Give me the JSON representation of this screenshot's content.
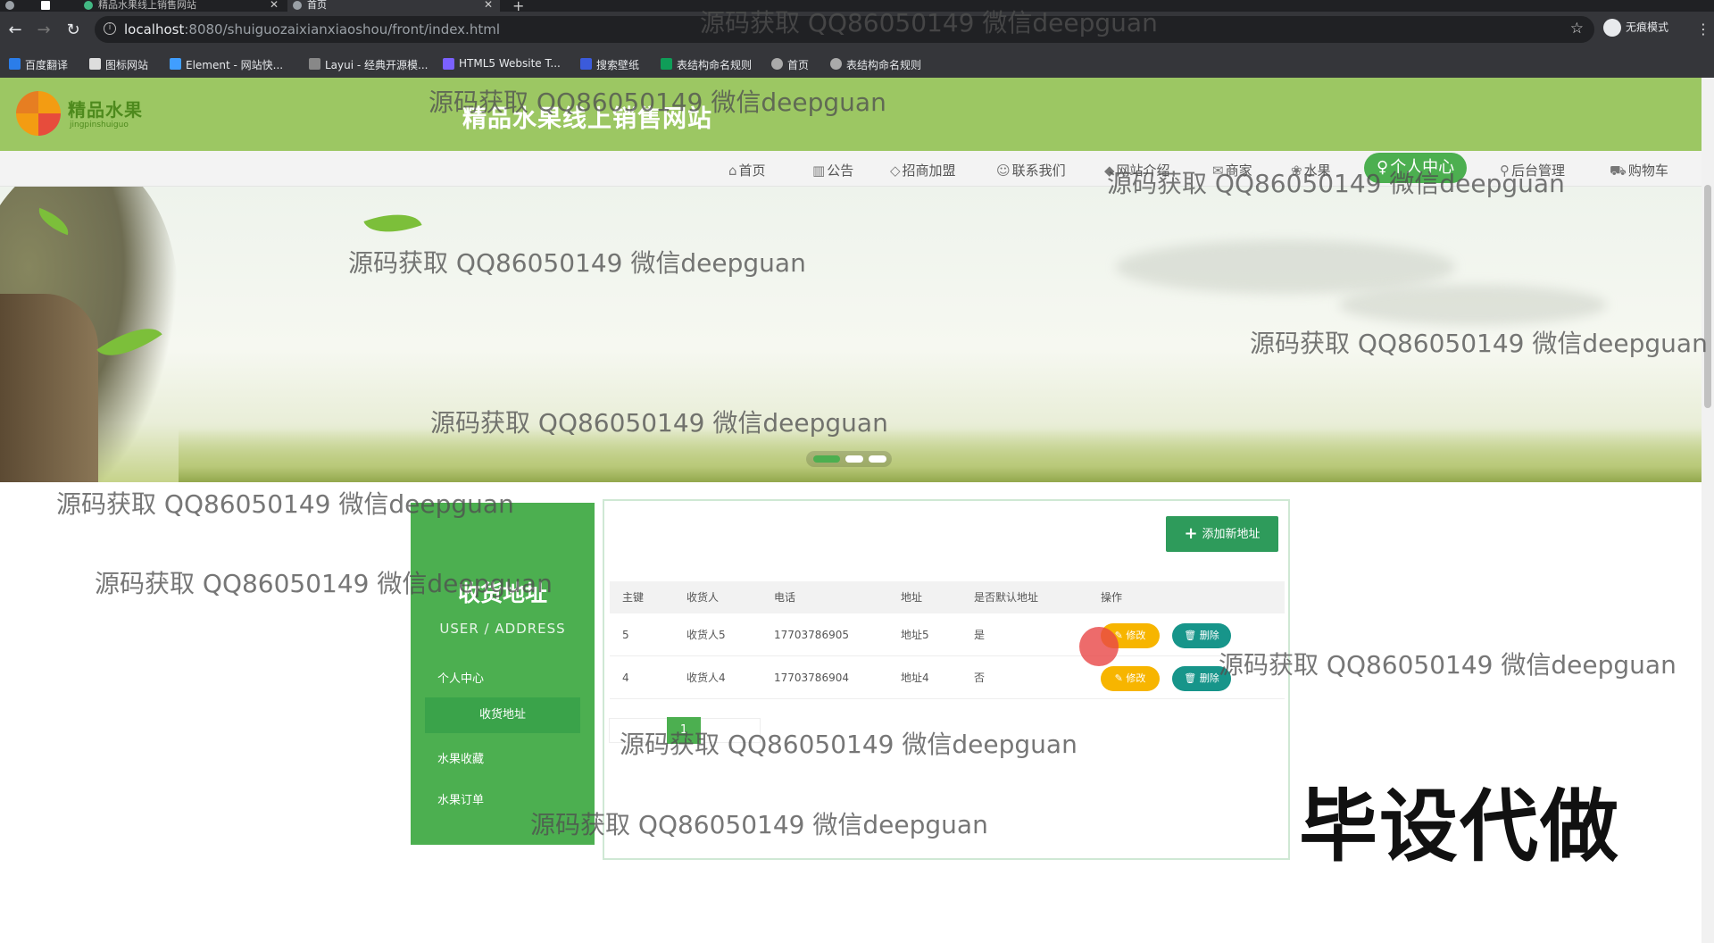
{
  "browser": {
    "tabs": [
      {
        "label": ""
      },
      {
        "label": "精品水果线上销售网站"
      },
      {
        "label": "首页"
      }
    ],
    "url_host": "localhost",
    "url_rest": ":8080/shuiguozaixianxiaoshou/front/index.html",
    "profile_label": "无痕模式",
    "bookmarks": [
      "百度翻译",
      "图标网站",
      "Element - 网站快...",
      "Layui - 经典开源模...",
      "HTML5 Website T...",
      "搜索壁纸",
      "表结构命名规则",
      "首页",
      "表结构命名规则"
    ]
  },
  "site": {
    "logo_text": "精品水果",
    "logo_sub": "jingpinshuiguo",
    "title": "精品水果线上销售网站"
  },
  "nav": [
    {
      "icon": "⌂",
      "label": "首页"
    },
    {
      "icon": "▥",
      "label": "公告"
    },
    {
      "icon": "◇",
      "label": "招商加盟"
    },
    {
      "icon": "☺",
      "label": "联系我们"
    },
    {
      "icon": "◆",
      "label": "网站介绍"
    },
    {
      "icon": "✉",
      "label": "商家"
    },
    {
      "icon": "❀",
      "label": "水果"
    },
    {
      "icon": "♀",
      "label": "个人中心"
    },
    {
      "icon": "⚲",
      "label": "后台管理"
    },
    {
      "icon": "⛟",
      "label": "购物车"
    }
  ],
  "sidebar": {
    "title": "收货地址",
    "subtitle": "USER / ADDRESS",
    "items": [
      "个人中心",
      "收货地址",
      "水果收藏",
      "水果订单"
    ]
  },
  "panel": {
    "add_button": "添加新地址",
    "columns": [
      "主键",
      "收货人",
      "电话",
      "地址",
      "是否默认地址",
      "操作"
    ],
    "rows": [
      {
        "id": "5",
        "name": "收货人5",
        "phone": "17703786905",
        "address": "地址5",
        "default": "是"
      },
      {
        "id": "4",
        "name": "收货人4",
        "phone": "17703786904",
        "address": "地址4",
        "default": "否"
      }
    ],
    "edit_label": "修改",
    "delete_label": "删除",
    "current_page": "1"
  },
  "watermark": "源码获取 QQ86050149 微信deepguan",
  "overlay_text": "毕设代做",
  "colors": {
    "header_green": "#9cc763",
    "primary_green": "#4caf50",
    "edit_yellow": "#f7b500",
    "delete_teal": "#17958a"
  }
}
